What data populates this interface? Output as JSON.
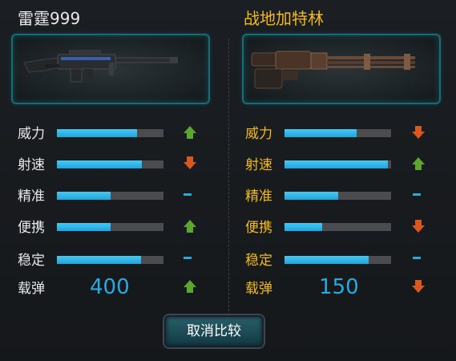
{
  "colors": {
    "left_text": "#e8e8e8",
    "right_text": "#f3ba1b",
    "bar_fill": "#2bb5e8",
    "bar_track": "#4a4c4f",
    "up_arrow": "#5aa62e",
    "down_arrow": "#d9581f",
    "dash": "#2aa9df",
    "ammo_value": "#2aa9df",
    "box_border": "#1e6a73"
  },
  "left": {
    "name": "雷霆999",
    "image_icon": "heavy-machine-gun",
    "stats": [
      {
        "label": "威力",
        "value": 0.75,
        "trend": "up"
      },
      {
        "label": "射速",
        "value": 0.8,
        "trend": "down"
      },
      {
        "label": "精准",
        "value": 0.5,
        "trend": "same"
      },
      {
        "label": "便携",
        "value": 0.5,
        "trend": "up"
      },
      {
        "label": "稳定",
        "value": 0.79,
        "trend": "same"
      }
    ],
    "ammo": {
      "label": "载弹",
      "value": "400",
      "trend": "up"
    }
  },
  "right": {
    "name": "战地加特林",
    "image_icon": "gatling-gun",
    "stats": [
      {
        "label": "威力",
        "value": 0.68,
        "trend": "down"
      },
      {
        "label": "射速",
        "value": 0.97,
        "trend": "up"
      },
      {
        "label": "精准",
        "value": 0.5,
        "trend": "same"
      },
      {
        "label": "便携",
        "value": 0.35,
        "trend": "down"
      },
      {
        "label": "稳定",
        "value": 0.79,
        "trend": "same"
      }
    ],
    "ammo": {
      "label": "载弹",
      "value": "150",
      "trend": "down"
    }
  },
  "cancel_button": {
    "label": "取消比较"
  }
}
